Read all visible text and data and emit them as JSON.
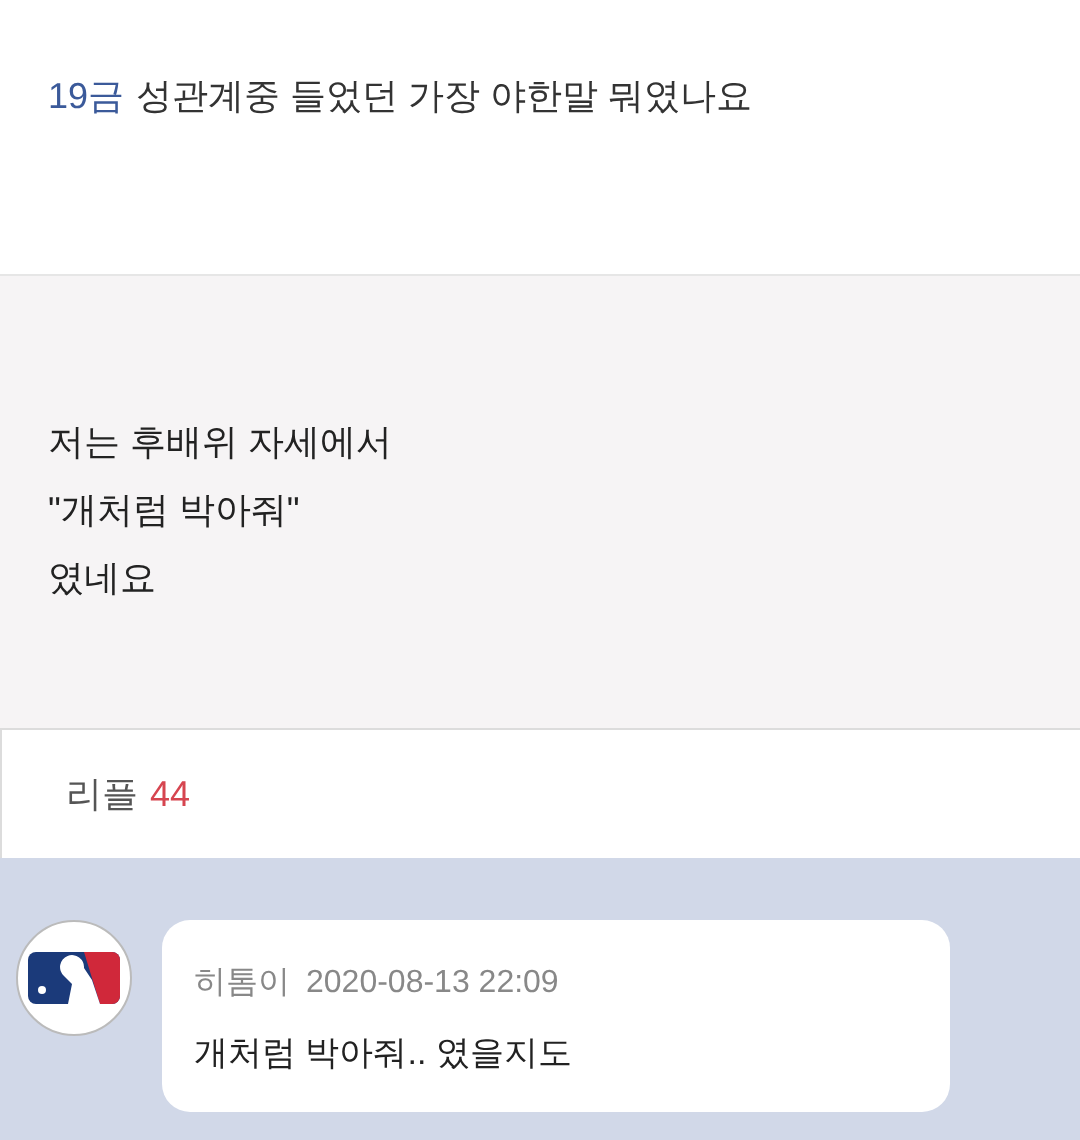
{
  "post": {
    "tag": "19금",
    "title": "성관계중 들었던 가장 야한말 뭐였나요",
    "body_lines": [
      "저는 후배위 자세에서",
      "\"개처럼 박아줘\"",
      "였네요"
    ]
  },
  "replies": {
    "label": "리플",
    "count": "44"
  },
  "comments": [
    {
      "author": "히톰이",
      "date": "2020-08-13 22:09",
      "text": "개처럼 박아줘.. 였을지도"
    }
  ]
}
